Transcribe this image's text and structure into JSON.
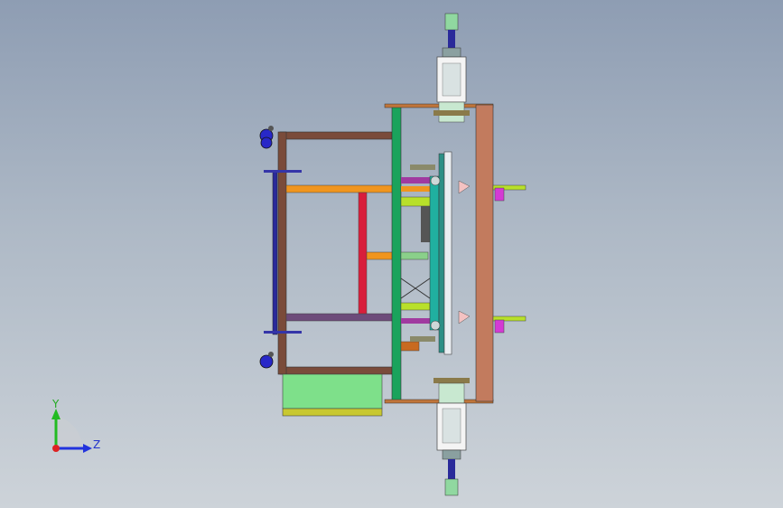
{
  "viewport": {
    "background_top": "#8e9db3",
    "background_bottom": "#cdd3d9"
  },
  "triad": {
    "y_label": "Y",
    "z_label": "Z",
    "y_color": "#22bb22",
    "z_color": "#2233dd",
    "x_color": "#dd2222"
  },
  "model": {
    "description_icon": "cad-assembly-model"
  }
}
